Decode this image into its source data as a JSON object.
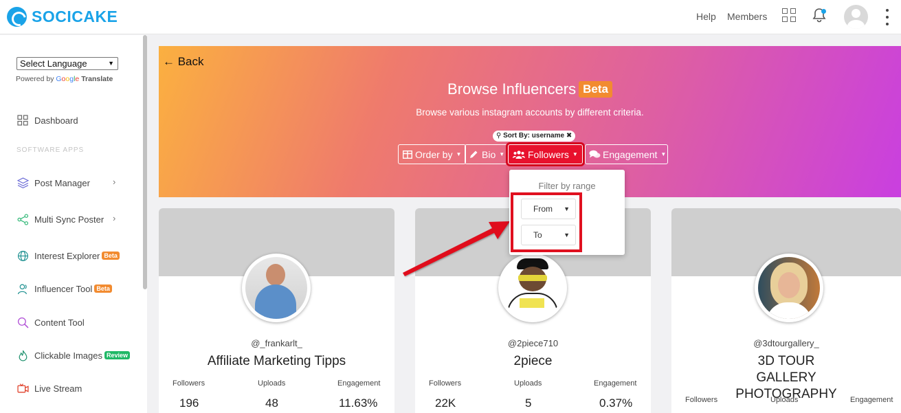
{
  "app": {
    "brand": "SOCICAKE",
    "nav": {
      "help": "Help",
      "members": "Members"
    },
    "colors": {
      "brand": "#1aa3e8",
      "badge_beta": "#f28b30",
      "badge_review": "#1fb866",
      "highlight": "#e0101f"
    }
  },
  "sidebar": {
    "language_select": "Select Language",
    "powered_by": "Powered by",
    "google": [
      "G",
      "o",
      "o",
      "g",
      "l",
      "e"
    ],
    "translate": "Translate",
    "section_label": "SOFTWARE APPS",
    "items": [
      {
        "label": "Dashboard",
        "icon": "dashboard-icon"
      },
      {
        "label": "Post Manager",
        "icon": "layers-icon",
        "has_children": true
      },
      {
        "label": "Multi Sync Poster",
        "icon": "share-icon",
        "has_children": true
      },
      {
        "label": "Interest Explorer",
        "icon": "globe-icon",
        "badge": "Beta"
      },
      {
        "label": "Influencer Tool",
        "icon": "users-icon",
        "badge": "Beta"
      },
      {
        "label": "Content Tool",
        "icon": "search-icon"
      },
      {
        "label": "Clickable Images",
        "icon": "fire-icon",
        "badge": "Review"
      },
      {
        "label": "Live Stream",
        "icon": "video-icon"
      }
    ]
  },
  "hero": {
    "back": "← Back",
    "title": "Browse Influencers",
    "title_badge": "Beta",
    "subtitle": "Browse various instagram accounts by different criteria.",
    "sort_pill": "Sort By: username",
    "filters": [
      {
        "label": "Order by",
        "icon": "table-icon"
      },
      {
        "label": "Bio",
        "icon": "pencil-icon"
      },
      {
        "label": "Followers",
        "icon": "users-icon",
        "active": true
      },
      {
        "label": "Engagement",
        "icon": "comments-icon"
      }
    ]
  },
  "dropdown": {
    "title": "Filter by range",
    "from": "From",
    "to": "To"
  },
  "cards": [
    {
      "handle": "@_frankarlt_",
      "name": "Affiliate Marketing Tipps",
      "stats": [
        {
          "label": "Followers",
          "value": "196"
        },
        {
          "label": "Uploads",
          "value": "48"
        },
        {
          "label": "Engagement",
          "value": "11.63%"
        }
      ]
    },
    {
      "handle": "@2piece710",
      "name": "2piece",
      "stats": [
        {
          "label": "Followers",
          "value": "22K"
        },
        {
          "label": "Uploads",
          "value": "5"
        },
        {
          "label": "Engagement",
          "value": "0.37%"
        }
      ]
    },
    {
      "handle": "@3dtourgallery_",
      "name": "3D TOUR GALLERY PHOTOGRAPHY",
      "stats": [
        {
          "label": "Followers",
          "value": ""
        },
        {
          "label": "Uploads",
          "value": ""
        },
        {
          "label": "Engagement",
          "value": ""
        }
      ]
    }
  ]
}
